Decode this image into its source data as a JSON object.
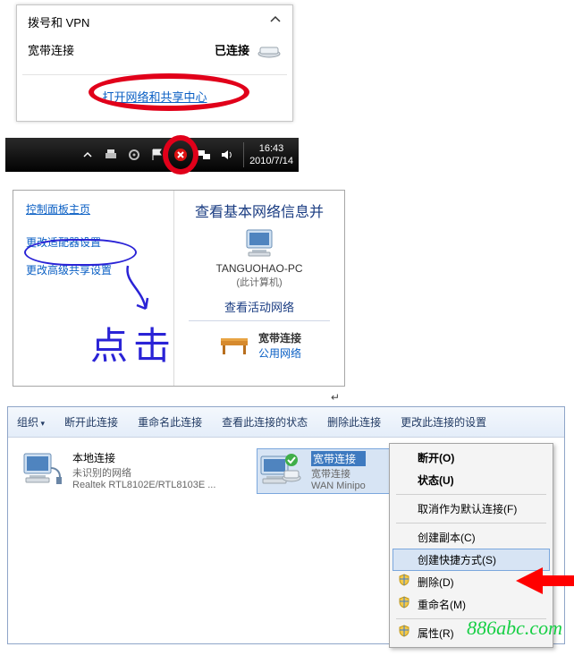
{
  "popup1": {
    "section_label": "拨号和 VPN",
    "conn_name": "宽带连接",
    "conn_status": "已连接",
    "open_center": "打开网络和共享中心"
  },
  "tray": {
    "time": "16:43",
    "date": "2010/7/14"
  },
  "popup2": {
    "home": "控制面板主页",
    "change_adapter": "更改适配器设置",
    "change_sharing": "更改高级共享设置",
    "heading": "查看基本网络信息并",
    "pc_name": "TANGUOHAO-PC",
    "pc_sub": "(此计算机)",
    "active_net": "查看活动网络",
    "net_name": "宽带连接",
    "net_type": "公用网络",
    "annotation": "点击"
  },
  "panel3": {
    "toolbar": {
      "organize": "组织",
      "disconnect": "断开此连接",
      "rename": "重命名此连接",
      "status": "查看此连接的状态",
      "delete": "删除此连接",
      "settings": "更改此连接的设置"
    },
    "local": {
      "title": "本地连接",
      "sub1": "未识别的网络",
      "sub2": "Realtek RTL8102E/RTL8103E ..."
    },
    "broadband": {
      "title": "宽带连接",
      "sub1": "宽带连接",
      "sub2": "WAN Minipo"
    },
    "menu": {
      "disconnect": "断开(O)",
      "status": "状态(U)",
      "unset_default": "取消作为默认连接(F)",
      "copy": "创建副本(C)",
      "shortcut": "创建快捷方式(S)",
      "delete": "删除(D)",
      "rename": "重命名(M)",
      "properties": "属性(R)"
    }
  },
  "watermark": "886abc.com"
}
